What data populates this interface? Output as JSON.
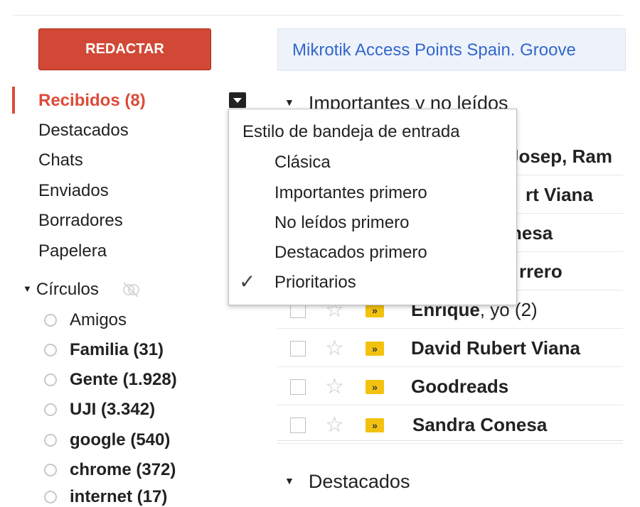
{
  "compose_label": "REDACTAR",
  "banner_text": "Mikrotik Access Points Spain. Groove",
  "nav": {
    "items": [
      {
        "label": "Recibidos (8)"
      },
      {
        "label": "Destacados"
      },
      {
        "label": "Chats"
      },
      {
        "label": "Enviados"
      },
      {
        "label": "Borradores"
      },
      {
        "label": "Papelera"
      }
    ]
  },
  "circles": {
    "heading": "Círculos",
    "items": [
      {
        "label": "Amigos"
      },
      {
        "label": "Familia (31)"
      },
      {
        "label": "Gente (1.928)"
      },
      {
        "label": "UJI (3.342)"
      },
      {
        "label": "google (540)"
      },
      {
        "label": "chrome (372)"
      },
      {
        "label": "internet (17)"
      }
    ]
  },
  "sections": {
    "important_unread": "Importantes y no leídos",
    "starred": "Destacados"
  },
  "messages": [
    {
      "sender": "Josep, Ram",
      "count": ""
    },
    {
      "sender": "rt Viana",
      "count": ""
    },
    {
      "sender": "nesa",
      "count": ""
    },
    {
      "sender": "rrero",
      "count": ""
    },
    {
      "sender": "Enrique",
      "rest": ", yo (2)"
    },
    {
      "sender": "David Rubert Viana",
      "rest": ""
    },
    {
      "sender": "Goodreads",
      "rest": ""
    },
    {
      "sender": "Sandra Conesa",
      "rest": ""
    }
  ],
  "menu": {
    "title": "Estilo de bandeja de entrada",
    "options": [
      {
        "label": "Clásica"
      },
      {
        "label": "Importantes primero"
      },
      {
        "label": "No leídos primero"
      },
      {
        "label": "Destacados primero"
      },
      {
        "label": "Prioritarios",
        "checked": true
      }
    ],
    "check_mark": "✓"
  },
  "icons": {
    "star": "☆",
    "important_marker": "»",
    "collapse_triangle": "▼"
  },
  "colors": {
    "compose_bg": "#d14836",
    "active_nav": "#dd4b39",
    "banner_link": "#3366cc",
    "important_marker": "#f2c20f"
  }
}
